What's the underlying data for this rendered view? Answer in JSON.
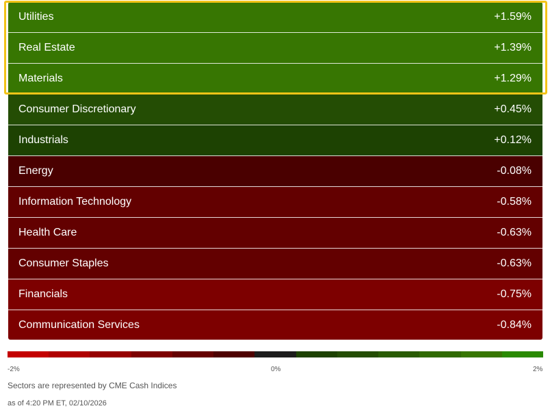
{
  "sectors": [
    {
      "name": "Utilities",
      "change": "+1.59%",
      "color": "#377602"
    },
    {
      "name": "Real Estate",
      "change": "+1.39%",
      "color": "#377602"
    },
    {
      "name": "Materials",
      "change": "+1.29%",
      "color": "#377602"
    },
    {
      "name": "Consumer Discretionary",
      "change": "+0.45%",
      "color": "#244d04"
    },
    {
      "name": "Industrials",
      "change": "+0.12%",
      "color": "#1d4202"
    },
    {
      "name": "Energy",
      "change": "-0.08%",
      "color": "#4a0000"
    },
    {
      "name": "Information Technology",
      "change": "-0.58%",
      "color": "#630000"
    },
    {
      "name": "Health Care",
      "change": "-0.63%",
      "color": "#630000"
    },
    {
      "name": "Consumer Staples",
      "change": "-0.63%",
      "color": "#630000"
    },
    {
      "name": "Financials",
      "change": "-0.75%",
      "color": "#7d0000"
    },
    {
      "name": "Communication Services",
      "change": "-0.84%",
      "color": "#7d0000"
    }
  ],
  "highlight_color": "#f2c318",
  "scale": {
    "colors": [
      "#c40000",
      "#b00000",
      "#960000",
      "#7d0000",
      "#650000",
      "#4d0000",
      "#1c1c1c",
      "#1d4202",
      "#244d04",
      "#2a5c04",
      "#306a03",
      "#377602",
      "#2a8a02"
    ],
    "min_label": "-2%",
    "mid_label": "0%",
    "max_label": "2%"
  },
  "footer": {
    "note": "Sectors are represented by CME Cash Indices",
    "as_of": "as of 4:20 PM ET, 02/10/2026"
  }
}
